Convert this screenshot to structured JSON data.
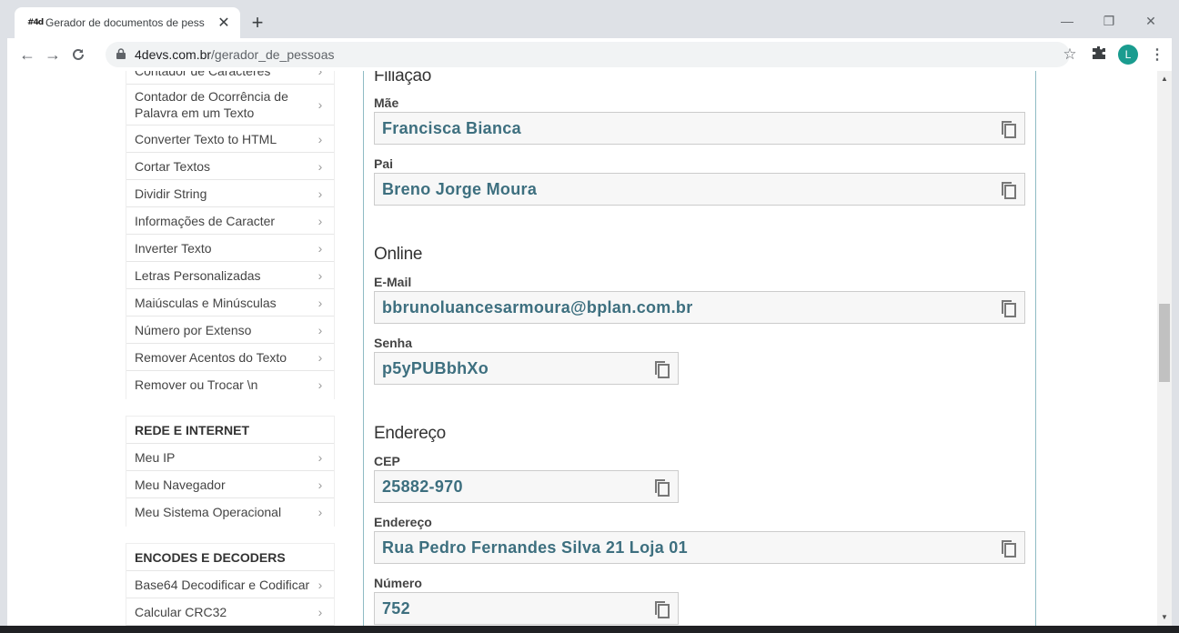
{
  "browser": {
    "tab_title": "Gerador de documentos de pess",
    "favicon_text": "#4d",
    "url_domain": "4devs.com.br",
    "url_path": "/gerador_de_pessoas",
    "avatar_letter": "L"
  },
  "sidebar": {
    "text_items": [
      {
        "label": "Contador de Caracteres"
      },
      {
        "label": "Contador de Ocorrência de Palavra em um Texto"
      },
      {
        "label": "Converter Texto to HTML"
      },
      {
        "label": "Cortar Textos"
      },
      {
        "label": "Dividir String"
      },
      {
        "label": "Informações de Caracter"
      },
      {
        "label": "Inverter Texto"
      },
      {
        "label": "Letras Personalizadas"
      },
      {
        "label": "Maiúsculas e Minúsculas"
      },
      {
        "label": "Número por Extenso"
      },
      {
        "label": "Remover Acentos do Texto"
      },
      {
        "label": "Remover ou Trocar \\n"
      }
    ],
    "rede_heading": "REDE E INTERNET",
    "rede_items": [
      {
        "label": "Meu IP"
      },
      {
        "label": "Meu Navegador"
      },
      {
        "label": "Meu Sistema Operacional"
      }
    ],
    "encodes_heading": "ENCODES E DECODERS",
    "encodes_items": [
      {
        "label": "Base64 Decodificar e Codificar"
      },
      {
        "label": "Calcular CRC32"
      }
    ]
  },
  "main": {
    "filiacao_title": "Filiação",
    "mae_label": "Mãe",
    "mae_value": "Francisca Bianca",
    "pai_label": "Pai",
    "pai_value": "Breno Jorge Moura",
    "online_title": "Online",
    "email_label": "E-Mail",
    "email_value": "bbrunoluancesarmoura@bplan.com.br",
    "senha_label": "Senha",
    "senha_value": "p5yPUBbhXo",
    "endereco_title": "Endereço",
    "cep_label": "CEP",
    "cep_value": "25882-970",
    "endereco_label": "Endereço",
    "endereco_value": "Rua Pedro Fernandes Silva 21 Loja 01",
    "numero_label": "Número",
    "numero_value": "752"
  }
}
